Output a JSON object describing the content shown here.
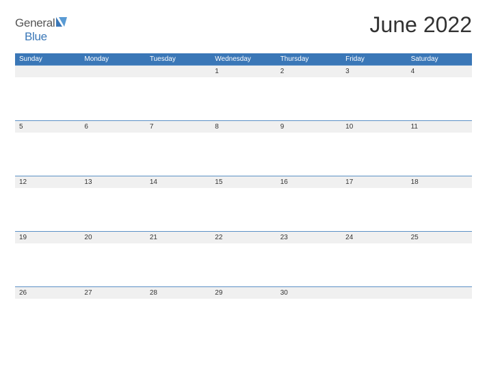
{
  "logo": {
    "text_general": "General",
    "text_blue": "Blue"
  },
  "title": "June 2022",
  "day_headers": [
    "Sunday",
    "Monday",
    "Tuesday",
    "Wednesday",
    "Thursday",
    "Friday",
    "Saturday"
  ],
  "weeks": [
    [
      "",
      "",
      "",
      "1",
      "2",
      "3",
      "4"
    ],
    [
      "5",
      "6",
      "7",
      "8",
      "9",
      "10",
      "11"
    ],
    [
      "12",
      "13",
      "14",
      "15",
      "16",
      "17",
      "18"
    ],
    [
      "19",
      "20",
      "21",
      "22",
      "23",
      "24",
      "25"
    ],
    [
      "26",
      "27",
      "28",
      "29",
      "30",
      "",
      ""
    ]
  ]
}
